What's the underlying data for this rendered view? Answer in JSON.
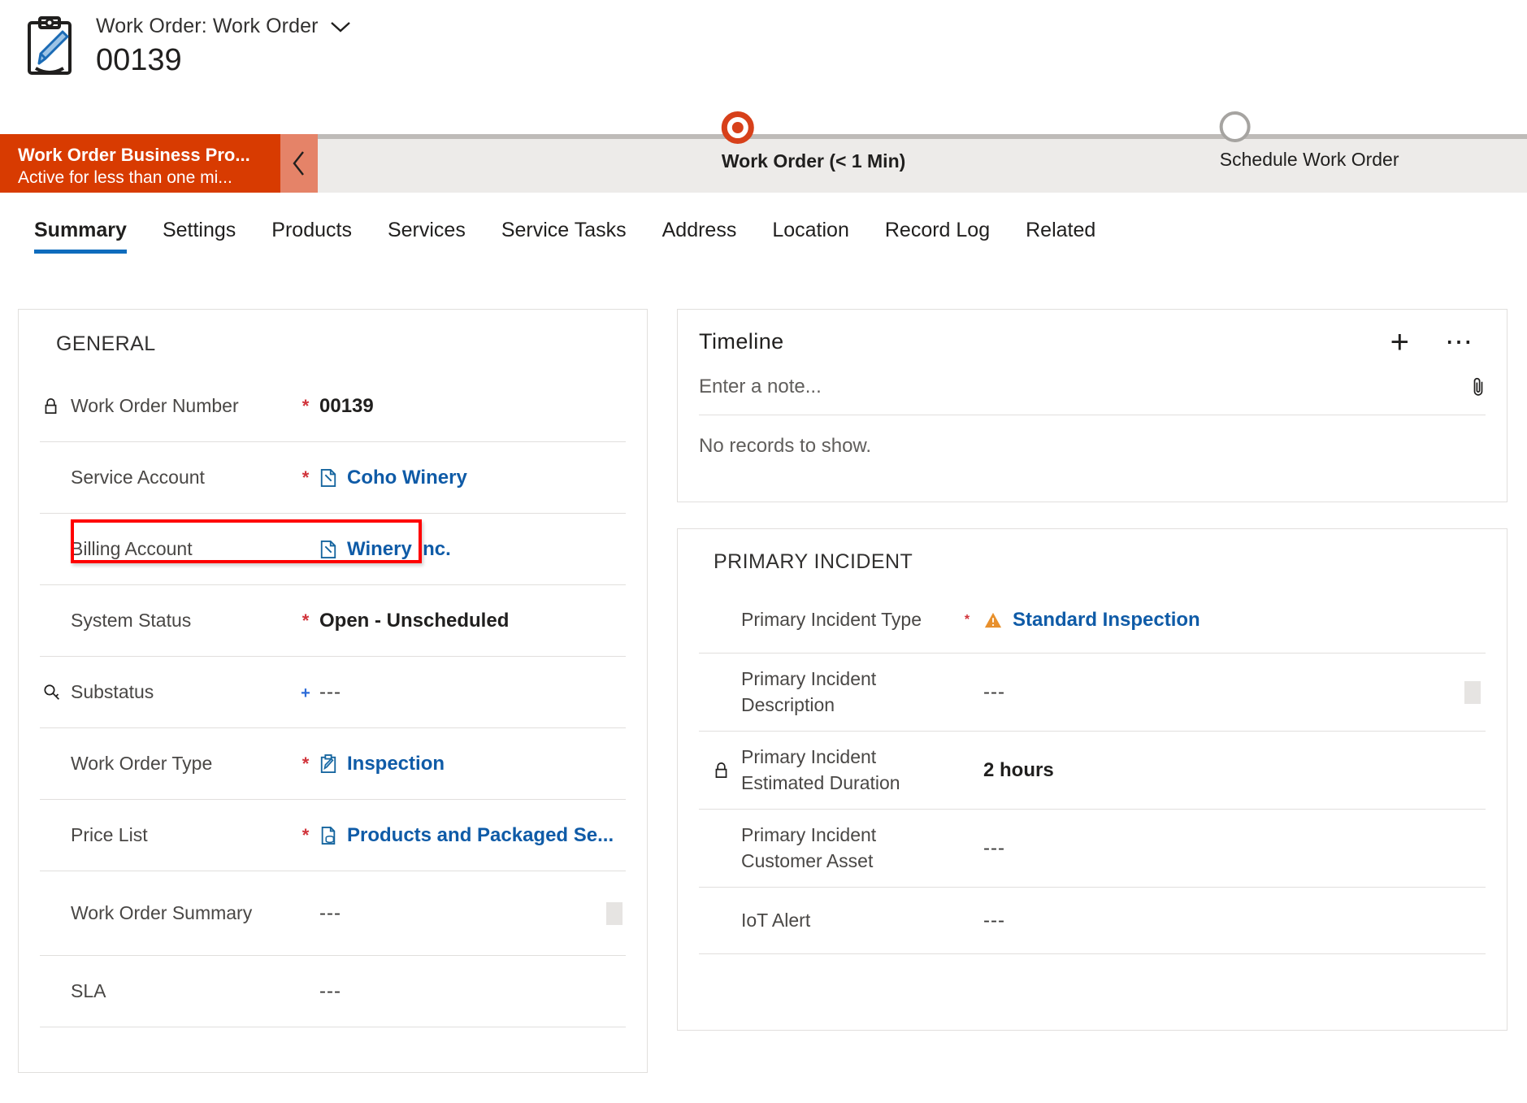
{
  "header": {
    "record_icon": "clipboard-pencil-icon",
    "entity_title": "Work Order: Work Order",
    "dropdown_icon": "chevron-down-icon",
    "record_name": "00139"
  },
  "business_process": {
    "name": "Work Order Business Pro...",
    "status": "Active for less than one mi...",
    "collapse_icon": "chevron-left-icon",
    "accent_color": "#D83B01",
    "stages": [
      {
        "label": "Work Order  (< 1 Min)",
        "state": "active",
        "position_pct": 41
      },
      {
        "label": "Schedule Work Order",
        "state": "upcoming",
        "position_pct": 82
      }
    ]
  },
  "tabs": [
    {
      "label": "Summary",
      "active": true
    },
    {
      "label": "Settings",
      "active": false
    },
    {
      "label": "Products",
      "active": false
    },
    {
      "label": "Services",
      "active": false
    },
    {
      "label": "Service Tasks",
      "active": false
    },
    {
      "label": "Address",
      "active": false
    },
    {
      "label": "Location",
      "active": false
    },
    {
      "label": "Record Log",
      "active": false
    },
    {
      "label": "Related",
      "active": false
    }
  ],
  "general": {
    "title": "GENERAL",
    "fields": [
      {
        "lead_icon": "lock-icon",
        "label": "Work Order Number",
        "required": "*",
        "value": "00139",
        "value_type": "strong"
      },
      {
        "lead_icon": "",
        "label": "Service Account",
        "required": "*",
        "value": "Coho Winery",
        "value_type": "link",
        "value_icon": "account-icon"
      },
      {
        "lead_icon": "",
        "label": "Billing Account",
        "required": "",
        "value": "Winery Inc.",
        "value_type": "link",
        "value_icon": "account-icon",
        "highlighted": true
      },
      {
        "lead_icon": "",
        "label": "System Status",
        "required": "*",
        "value": "Open - Unscheduled",
        "value_type": "strong"
      },
      {
        "lead_icon": "key-icon",
        "label": "Substatus",
        "required": "+",
        "value": "---",
        "value_type": "empty"
      },
      {
        "lead_icon": "",
        "label": "Work Order Type",
        "required": "*",
        "value": "Inspection",
        "value_type": "link",
        "value_icon": "work-order-type-icon"
      },
      {
        "lead_icon": "",
        "label": "Price List",
        "required": "*",
        "value": "Products and Packaged Se...",
        "value_type": "link",
        "value_icon": "price-list-icon"
      },
      {
        "lead_icon": "",
        "label": "Work Order Summary",
        "required": "",
        "value": "---",
        "value_type": "empty",
        "resizer": true
      },
      {
        "lead_icon": "",
        "label": "SLA",
        "required": "",
        "value": "---",
        "value_type": "empty"
      }
    ]
  },
  "timeline": {
    "title": "Timeline",
    "add_icon": "plus-icon",
    "more_icon": "more-options-icon",
    "note_placeholder": "Enter a note...",
    "attach_icon": "paperclip-icon",
    "empty_text": "No records to show."
  },
  "primary_incident": {
    "title": "PRIMARY INCIDENT",
    "fields": [
      {
        "lead_icon": "",
        "label": "Primary Incident Type",
        "required": "*",
        "value": "Standard Inspection",
        "value_type": "link",
        "value_icon": "warning-triangle-icon"
      },
      {
        "lead_icon": "",
        "label": "Primary Incident Description",
        "required": "",
        "value": "---",
        "value_type": "empty",
        "resizer": true
      },
      {
        "lead_icon": "lock-icon",
        "label": "Primary Incident Estimated Duration",
        "required": "",
        "value": "2 hours",
        "value_type": "strong"
      },
      {
        "lead_icon": "",
        "label": "Primary Incident Customer Asset",
        "required": "",
        "value": "---",
        "value_type": "empty"
      },
      {
        "lead_icon": "",
        "label": "IoT Alert",
        "required": "",
        "value": "---",
        "value_type": "empty"
      }
    ]
  },
  "colors": {
    "bpf_red": "#D83B01",
    "highlight_red": "#FF0000",
    "link_blue": "#0F5BA7",
    "tab_accent": "#0F6CBD",
    "required_red": "#D1343B",
    "warning_orange": "#E8902C"
  }
}
